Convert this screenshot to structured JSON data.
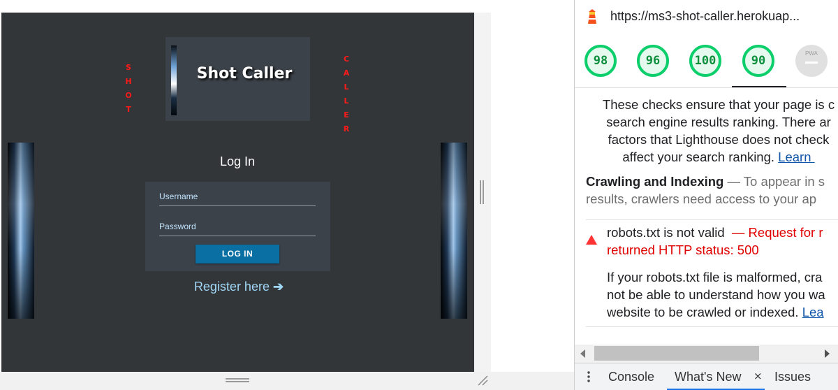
{
  "emulated_page": {
    "left_vertical_word": [
      "S",
      "H",
      "O",
      "T"
    ],
    "right_vertical_word": [
      "C",
      "A",
      "L",
      "L",
      "E",
      "R"
    ],
    "logo_title": "Shot Caller",
    "login_heading": "Log In",
    "username_label": "Username",
    "password_label": "Password",
    "login_button": "LOG IN",
    "register_link": "Register here",
    "register_arrow": "➔"
  },
  "devtools": {
    "url": "https://ms3-shot-caller.herokuap...",
    "scores": [
      {
        "value": "98",
        "fraction": 0.98
      },
      {
        "value": "96",
        "fraction": 0.96
      },
      {
        "value": "100",
        "fraction": 1.0
      },
      {
        "value": "90",
        "fraction": 0.9
      }
    ],
    "pwa_label": "PWA",
    "intro_lines": [
      "These checks ensure that your page is c",
      "search engine results ranking. There ar",
      "factors that Lighthouse does not check",
      "affect your search ranking. "
    ],
    "intro_link": "Learn ",
    "crawl_heading": "Crawling and Indexing",
    "crawl_rest_line1": " — To appear in s",
    "crawl_line2": "results, crawlers need access to your ap",
    "robots_title": "robots.txt is not valid ",
    "robots_error_line1": " — Request for r",
    "robots_error_line2": "returned HTTP status: 500",
    "robots_desc_line1": "If your robots.txt file is malformed, cra",
    "robots_desc_line2": "not be able to understand how you wa",
    "robots_desc_line3": "website to be crawled or indexed. ",
    "robots_desc_link": "Lea",
    "drawer_tabs": {
      "console": "Console",
      "whats_new": "What's New",
      "close": "×",
      "issues": "Issues"
    },
    "colors": {
      "pass": "#0cce6b",
      "error": "#e00000",
      "link": "#1155aa"
    }
  }
}
